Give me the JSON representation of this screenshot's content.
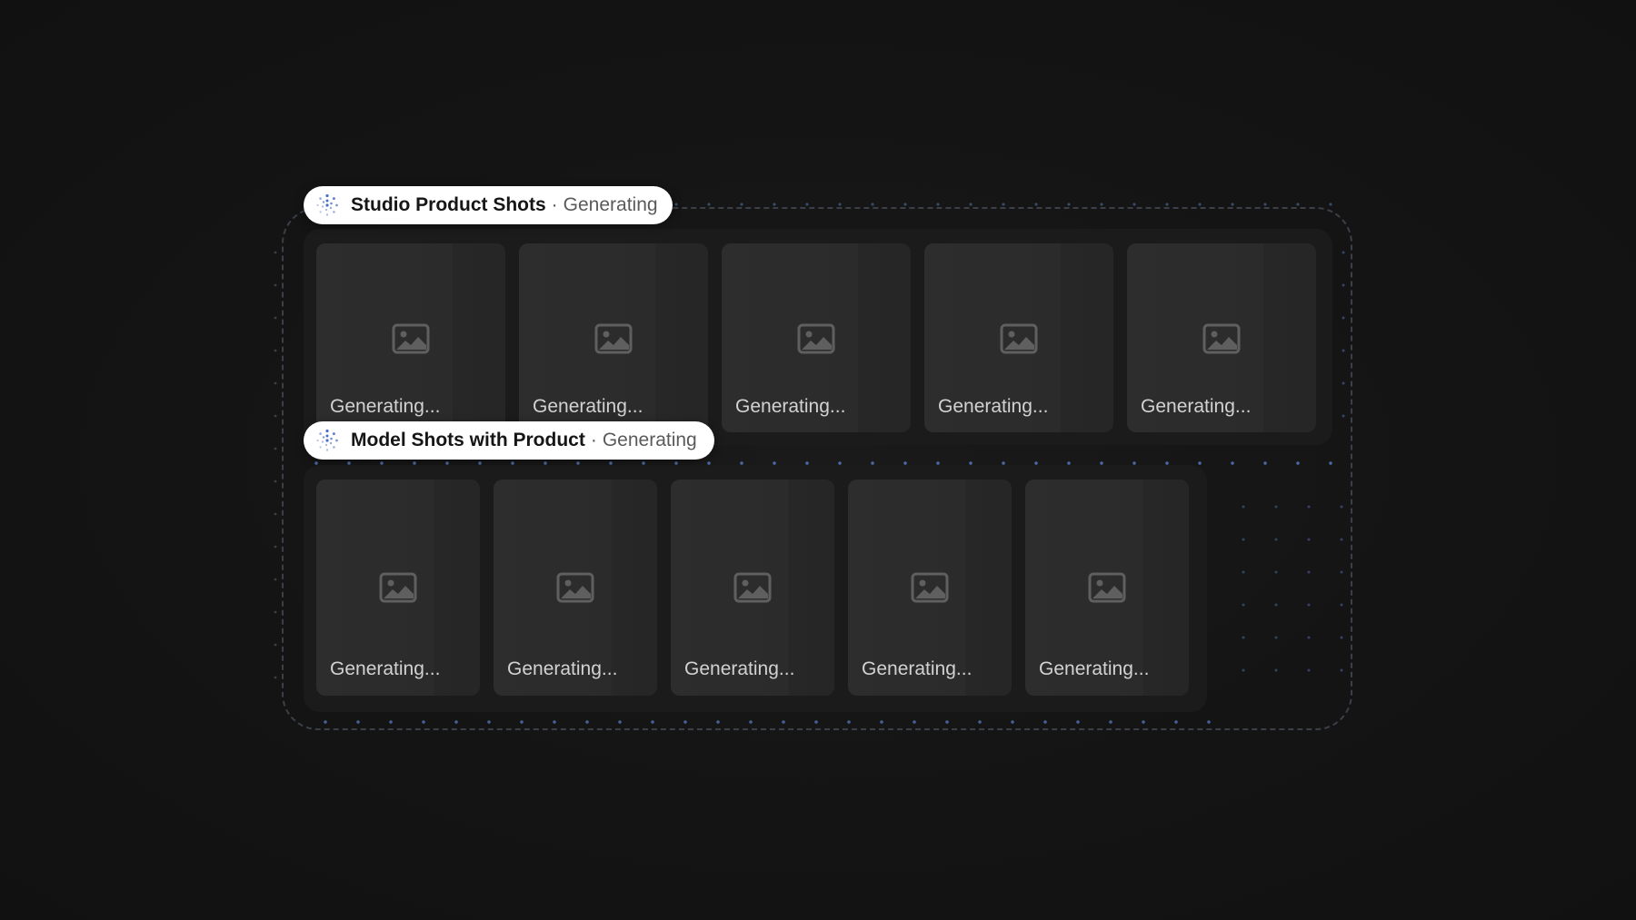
{
  "colors": {
    "background": "#131313",
    "panel": "#1b1b1b",
    "card": "#2c2c2c",
    "pill_bg": "#ffffff",
    "accent_dots": "#5b82cc",
    "frame_border": "#3b3f47"
  },
  "groups": [
    {
      "title": "Studio Product Shots",
      "separator": "·",
      "status": "Generating",
      "icon": "sparkle-loader-icon",
      "cards": [
        {
          "label": "Generating...",
          "icon": "image-placeholder-icon"
        },
        {
          "label": "Generating...",
          "icon": "image-placeholder-icon"
        },
        {
          "label": "Generating...",
          "icon": "image-placeholder-icon"
        },
        {
          "label": "Generating...",
          "icon": "image-placeholder-icon"
        },
        {
          "label": "Generating...",
          "icon": "image-placeholder-icon"
        }
      ]
    },
    {
      "title": "Model Shots with Product",
      "separator": "·",
      "status": "Generating",
      "icon": "sparkle-loader-icon",
      "cards": [
        {
          "label": "Generating...",
          "icon": "image-placeholder-icon"
        },
        {
          "label": "Generating...",
          "icon": "image-placeholder-icon"
        },
        {
          "label": "Generating...",
          "icon": "image-placeholder-icon"
        },
        {
          "label": "Generating...",
          "icon": "image-placeholder-icon"
        },
        {
          "label": "Generating...",
          "icon": "image-placeholder-icon"
        }
      ]
    }
  ]
}
